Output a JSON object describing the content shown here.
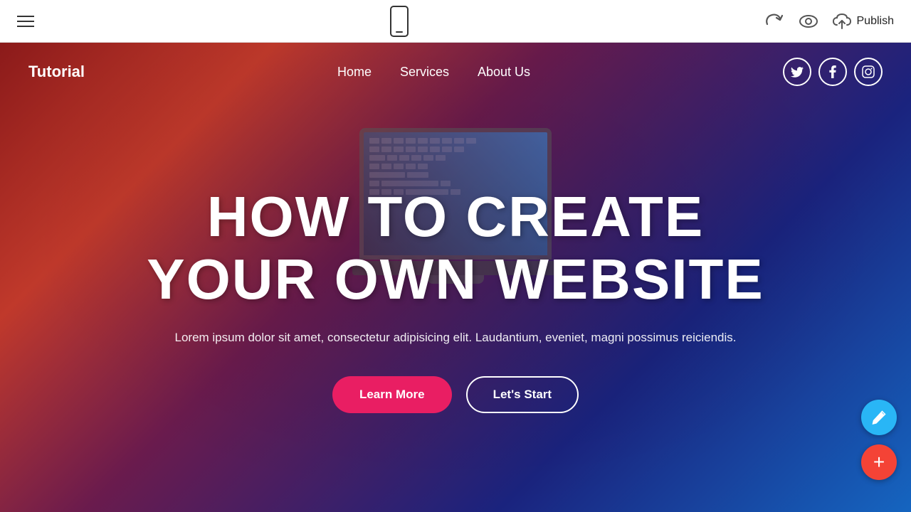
{
  "toolbar": {
    "publish_label": "Publish"
  },
  "site": {
    "logo": "Tutorial",
    "nav": {
      "links": [
        {
          "label": "Home"
        },
        {
          "label": "Services"
        },
        {
          "label": "About Us"
        }
      ],
      "socials": [
        {
          "name": "twitter",
          "symbol": "𝕋"
        },
        {
          "name": "facebook",
          "symbol": "f"
        },
        {
          "name": "instagram",
          "symbol": "📷"
        }
      ]
    }
  },
  "hero": {
    "title_line1": "HOW TO CREATE",
    "title_line2": "YOUR OWN WEBSITE",
    "description": "Lorem ipsum dolor sit amet, consectetur adipisicing elit. Laudantium, eveniet, magni possimus reiciendis.",
    "btn_learn_more": "Learn More",
    "btn_lets_start": "Let's Start"
  }
}
